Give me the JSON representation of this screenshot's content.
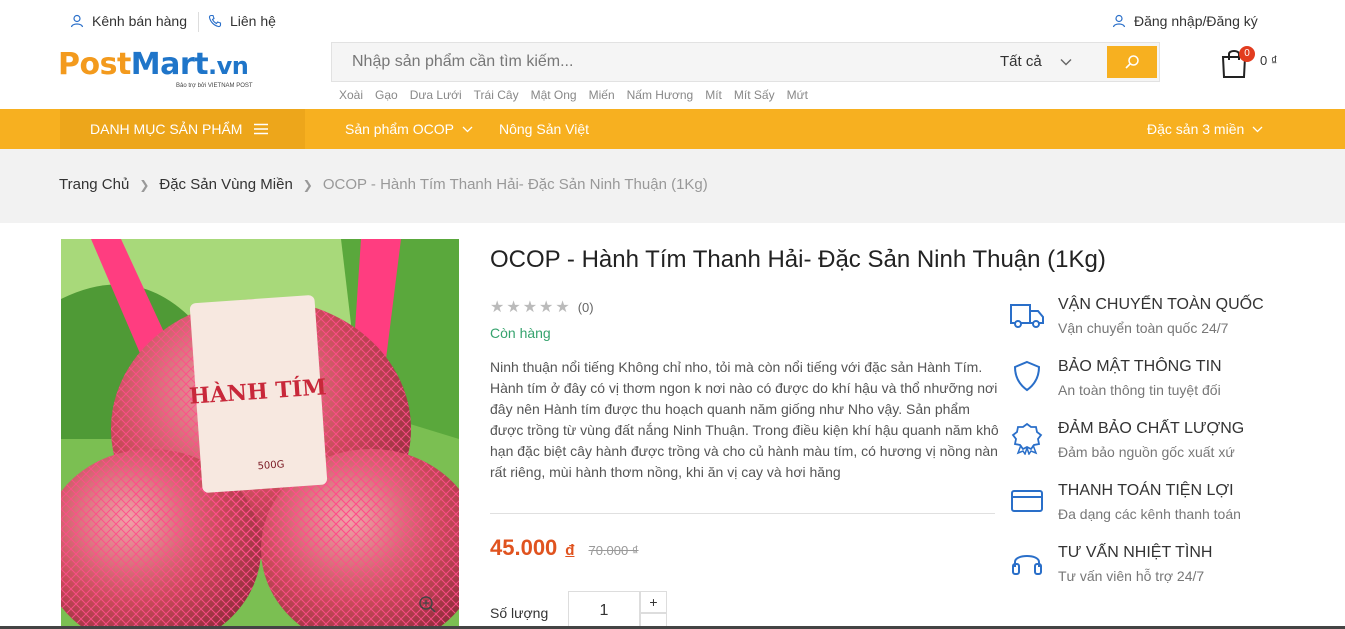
{
  "topbar": {
    "seller_channel": "Kênh bán hàng",
    "contact": "Liên hệ",
    "login": "Đăng nhập/Đăng ký"
  },
  "logo": {
    "brand_part1": "Post",
    "brand_part2": "Mart",
    "brand_part3": ".vn",
    "sub": "Bảo trợ bởi VIETNAM POST"
  },
  "search": {
    "placeholder": "Nhập sản phẩm cần tìm kiếm...",
    "category": "Tất cả"
  },
  "keywords": [
    "Xoài",
    "Gạo",
    "Dưa Lưới",
    "Trái Cây",
    "Mật Ong",
    "Miến",
    "Nấm Hương",
    "Mít",
    "Mít Sấy",
    "Mứt"
  ],
  "cart": {
    "count": "0",
    "amount": "0 ₫"
  },
  "nav": {
    "categories": "DANH MỤC SẢN PHẨM",
    "ocop": "Sản phẩm OCOP",
    "nong_san": "Nông Sản Việt",
    "dac_san": "Đặc sản 3 miền"
  },
  "breadcrumb": {
    "home": "Trang Chủ",
    "category": "Đặc Sản Vùng Miền",
    "current": "OCOP - Hành Tím Thanh Hải- Đặc Sản Ninh Thuận (1Kg)"
  },
  "product": {
    "title": "OCOP - Hành Tím Thanh Hải- Đặc Sản Ninh Thuận (1Kg)",
    "rating_count": "(0)",
    "rating": 0,
    "stock": "Còn hàng",
    "description": "Ninh thuận nổi tiếng Không chỉ nho, tỏi mà còn nổi tiếng với đặc sản Hành Tím. Hành tím ở đây có vị thơm ngon k nơi nào có được do khí hậu và thổ nhưỡng nơi đây nên Hành tím được thu hoạch quanh năm giống như Nho vậy. Sản phẩm được trồng từ vùng đất nắng Ninh Thuận. Trong điều kiện khí hậu quanh năm khô hạn đặc biệt cây hành được trồng và cho củ hành màu tím, có hương vị nồng nàn rất riêng, mùi hành thơm nồng, khi ăn vị cay và hơi hăng",
    "price": "45.000",
    "currency": "đ",
    "old_price": "70.000 ₫",
    "qty_label": "Số lượng",
    "qty_value": "1",
    "qty_plus": "+",
    "image_bag_label": "HÀNH TÍM",
    "image_bag_weight": "500G"
  },
  "features": [
    {
      "icon": "truck-icon",
      "title": "VẬN CHUYỂN TOÀN QUỐC",
      "sub": "Vận chuyển toàn quốc 24/7"
    },
    {
      "icon": "shield-icon",
      "title": "BẢO MẬT THÔNG TIN",
      "sub": "An toàn thông tin tuyệt đối"
    },
    {
      "icon": "award-icon",
      "title": "ĐẢM BẢO CHẤT LƯỢNG",
      "sub": "Đảm bảo nguồn gốc xuất xứ"
    },
    {
      "icon": "credit-card-icon",
      "title": "THANH TOÁN TIỆN LỢI",
      "sub": "Đa dạng các kênh thanh toán"
    },
    {
      "icon": "headset-icon",
      "title": "TƯ VẤN NHIỆT TÌNH",
      "sub": "Tư vấn viên hỗ trợ 24/7"
    }
  ],
  "colors": {
    "accent": "#f7b020",
    "price": "#e0531f",
    "stock": "#36a36e",
    "icon_blue": "#2a6fc9",
    "logo_orange": "#f39a1d",
    "logo_blue": "#1f75c9"
  }
}
